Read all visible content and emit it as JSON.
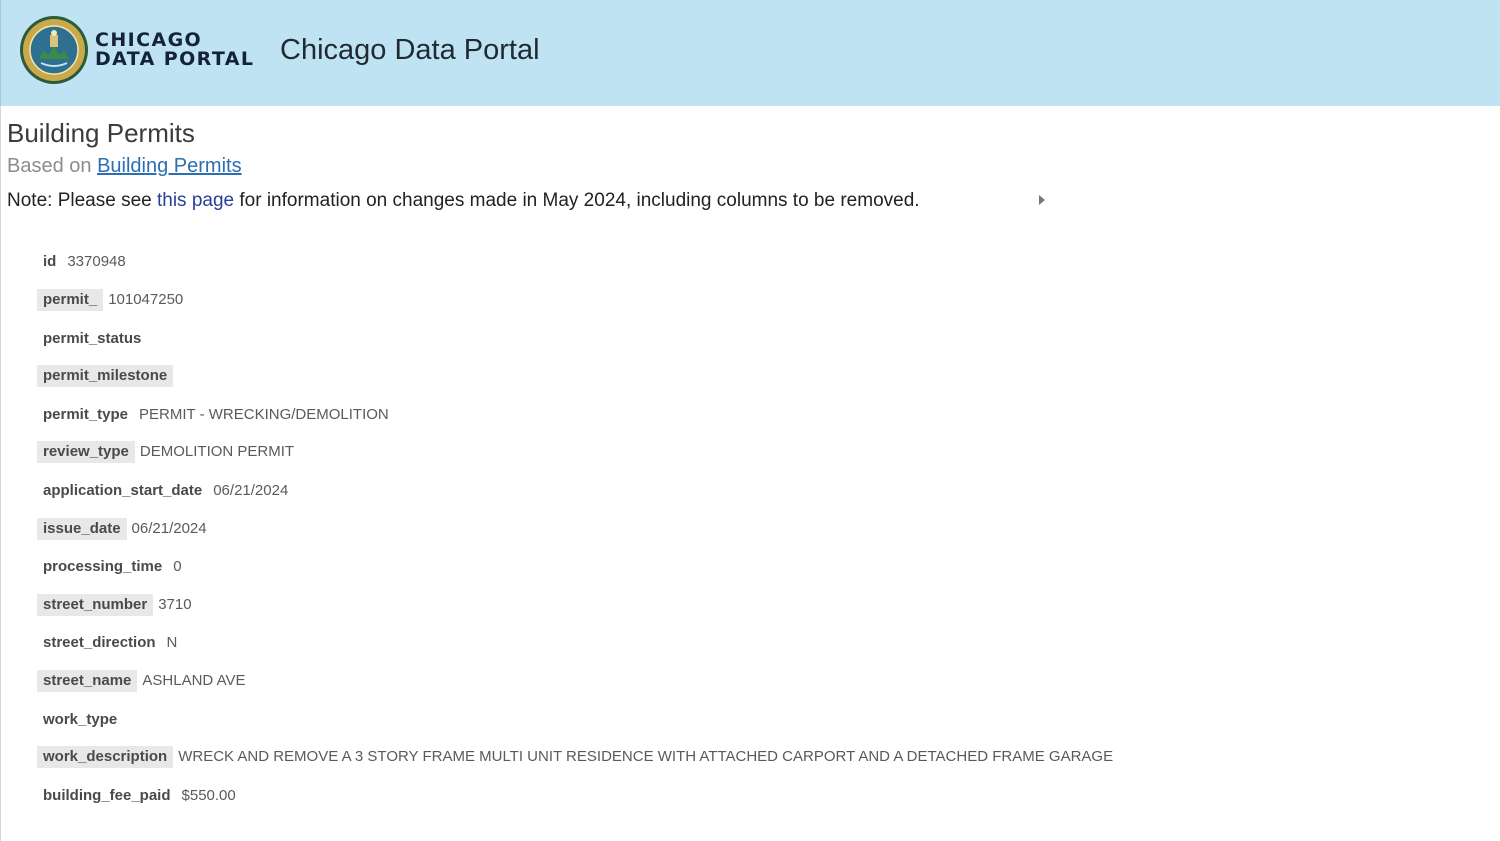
{
  "header": {
    "logo_line1": "CHICAGO",
    "logo_line2": "DATA PORTAL",
    "site_title": "Chicago Data Portal",
    "bg_color": "#bfe3f3",
    "logo_icon": "city-seal-icon"
  },
  "dataset": {
    "title": "Building Permits",
    "based_on_prefix": "Based on",
    "based_on_link": "Building Permits"
  },
  "note": {
    "prefix": "Note: Please see ",
    "link": "this page",
    "suffix": " for information on changes made in May 2024, including columns to be removed."
  },
  "fields": [
    {
      "key": "id",
      "value": "3370948"
    },
    {
      "key": "permit_",
      "value": "101047250"
    },
    {
      "key": "permit_status",
      "value": ""
    },
    {
      "key": "permit_milestone",
      "value": ""
    },
    {
      "key": "permit_type",
      "value": "PERMIT - WRECKING/DEMOLITION"
    },
    {
      "key": "review_type",
      "value": "DEMOLITION PERMIT"
    },
    {
      "key": "application_start_date",
      "value": "06/21/2024"
    },
    {
      "key": "issue_date",
      "value": "06/21/2024"
    },
    {
      "key": "processing_time",
      "value": "0"
    },
    {
      "key": "street_number",
      "value": "3710"
    },
    {
      "key": "street_direction",
      "value": "N"
    },
    {
      "key": "street_name",
      "value": "ASHLAND AVE"
    },
    {
      "key": "work_type",
      "value": ""
    },
    {
      "key": "work_description",
      "value": "WRECK AND REMOVE A 3 STORY FRAME MULTI UNIT RESIDENCE WITH ATTACHED CARPORT AND A DETACHED FRAME GARAGE"
    },
    {
      "key": "building_fee_paid",
      "value": "$550.00"
    }
  ]
}
